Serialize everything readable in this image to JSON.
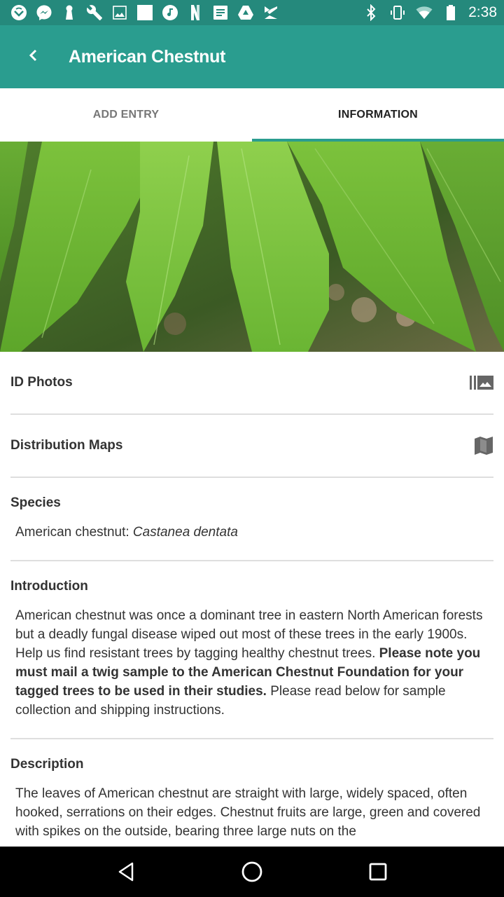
{
  "status_bar": {
    "time": "2:38",
    "left_icons": [
      "vudu-icon",
      "messenger-icon",
      "keyhole-icon",
      "wrench-icon",
      "image-icon",
      "square-icon",
      "music-icon",
      "netflix-icon",
      "notes-icon",
      "drive-icon",
      "check-icon"
    ],
    "right_icons": [
      "bluetooth-icon",
      "vibrate-icon",
      "wifi-icon",
      "battery-icon"
    ]
  },
  "app_bar": {
    "title": "American Chestnut",
    "back_icon": "chevron-left-icon"
  },
  "tabs": [
    {
      "label": "ADD ENTRY",
      "active": false
    },
    {
      "label": "INFORMATION",
      "active": true
    }
  ],
  "colors": {
    "status_bar": "#25897c",
    "app_bar": "#2a9d8f",
    "accent": "#2a9d8f",
    "divider": "#dedede",
    "text": "#333333"
  },
  "hero_image": {
    "alt": "American chestnut leaves"
  },
  "links": [
    {
      "label": "ID Photos",
      "icon": "photo-library-icon"
    },
    {
      "label": "Distribution Maps",
      "icon": "map-icon"
    }
  ],
  "sections": {
    "species": {
      "heading": "Species",
      "common": "American chestnut: ",
      "scientific": "Castanea dentata"
    },
    "introduction": {
      "heading": "Introduction",
      "text_1": "American chestnut was once a dominant tree in eastern North American forests but a deadly fungal disease wiped out most of these trees in the early 1900s. Help us find resistant trees by tagging healthy chestnut trees. ",
      "text_bold": "Please note you must mail a twig sample to the American Chestnut Foundation for your tagged trees to be used in their studies.",
      "text_2": " Please read below for sample collection and shipping instructions."
    },
    "description": {
      "heading": "Description",
      "text": "The leaves of American chestnut are straight with large, widely spaced, often hooked, serrations on their edges. Chestnut fruits are large, green and covered with spikes on the outside, bearing three large nuts on the"
    }
  },
  "nav_bar": {
    "buttons": [
      "back-triangle-icon",
      "home-circle-icon",
      "recents-square-icon"
    ]
  }
}
